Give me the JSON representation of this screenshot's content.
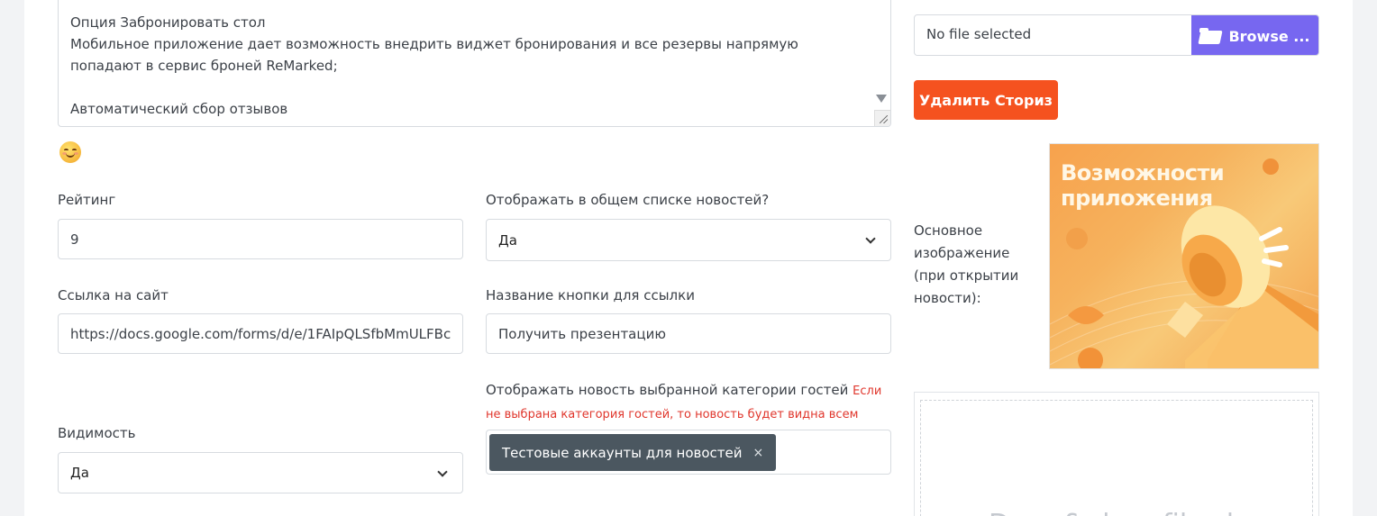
{
  "description": {
    "text": "Опция Забронировать стол\nМобильное приложение дает возможность внедрить виджет бронирования и все резервы напрямую попадают в сервис броней ReMarked;\n\nАвтоматический сбор отзывов"
  },
  "emoji_icon": "smiling-face-icon",
  "rating": {
    "label": "Рейтинг",
    "value": "9"
  },
  "show_in_list": {
    "label": "Отображать в общем списке новостей?",
    "value": "Да"
  },
  "site_link": {
    "label": "Ссылка на сайт",
    "value": "https://docs.google.com/forms/d/e/1FAIpQLSfbMmULFBc"
  },
  "button_name": {
    "label": "Название кнопки для ссылки",
    "value": "Получить презентацию"
  },
  "guest_category": {
    "label": "Отображать новость выбранной категории гостей",
    "hint": "Если не выбрана категория гостей, то новость будет видна всем",
    "tags": [
      "Тестовые аккаунты для новостей"
    ],
    "tag_remove": "×"
  },
  "visibility": {
    "label": "Видимость",
    "value": "Да"
  },
  "file_upload": {
    "placeholder": "No file selected",
    "browse_label": "Browse ..."
  },
  "delete_story_label": "Удалить Сториз",
  "main_image": {
    "label": "Основное изображение (при открытии новости):",
    "preview_text": "Возможности приложения"
  },
  "dropzone": {
    "text": "Drag & drop files here"
  },
  "colors": {
    "accent_purple": "#7767f0",
    "danger_orange": "#f5521f",
    "tag_bg": "#4b5760",
    "hint_red": "#e0362c"
  }
}
